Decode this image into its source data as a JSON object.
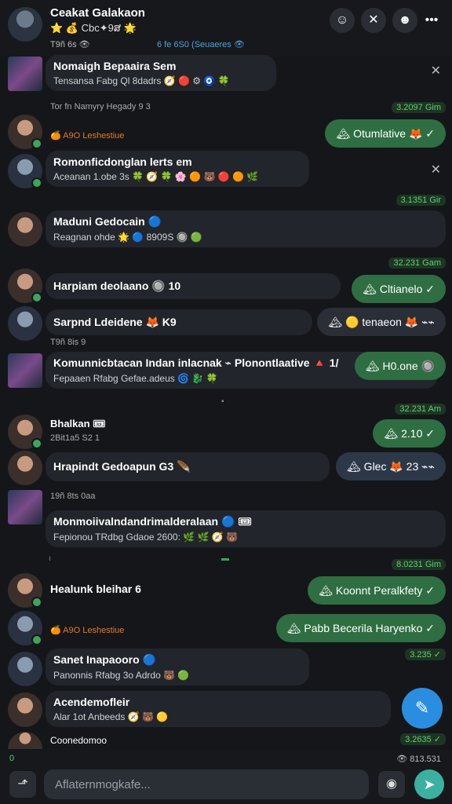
{
  "header": {
    "title": "Ceakat Galakaon",
    "subtitle": "⭐ 💰 Cbc✦9ສ 🌟",
    "meta_left": "T9ñ 6s 👁",
    "meta_center": "6 fe 6S0 (Seuaeres 👁",
    "icons": {
      "profile": "profile-icon",
      "close": "close-icon",
      "user": "user-icon",
      "more": "more-icon"
    },
    "more_glyph": "•••",
    "close_glyph": "✕"
  },
  "messages": [
    {
      "title": "Nomaigh Bepaaira Sem",
      "sub": "Tensansa Fabg Ql 8dadrs 🧭 🔴 ⚙ 🧿 🍀",
      "close": "✕"
    },
    {
      "meta": "Tor fn Namyry Hegady 9 3",
      "time": "3.2097 Gim"
    },
    {
      "meta": "🍊 A9O Leshestiue",
      "pill": "🏔 Otumlative 🦊 ✓"
    },
    {
      "title": "Romonficdonglan lerts em",
      "sub": "Aceanan 1.obe 3s 🍀 🧭 🍀 🌸 🟠 🐻 🔴 🟠 🌿",
      "close": "✕"
    },
    {
      "time": "3.1351 Gir"
    },
    {
      "title": "Maduni Gedocain 🔵",
      "sub": "Reagnan ohde 🌟 🔵 8909S 🔘 🟢"
    },
    {
      "time": "32.231 Gam"
    },
    {
      "title": "Harpiam deolaano 🔘 10",
      "pill": "🏔 Cltianelo ✓"
    },
    {
      "title": "Sarpnd Ldeidene 🦊 K9",
      "pill": "🏔 🟡 tenaeon 🦊 ⌁⌁"
    },
    {
      "meta": "T9ñ 8is 9"
    },
    {
      "title": "Komunnicbtacan Indan inlacnak ⌁ Plonontlaative 🔺 1/",
      "sub": "Fepaaen Rfabg Gefae.adeus 🌀 🐉 🍀",
      "pill": "🏔 H0.one 🔘"
    },
    {
      "time": "32.231 Am"
    },
    {
      "title": "Bhalkan 🎟",
      "sub": "2Bit1a5 S2 1",
      "pill": "🏔 2.10 ✓"
    },
    {
      "title": "Hrapindt Gedoapun G3 🪶",
      "pill": "🏔 Glec 🦊 23 ⌁⌁"
    },
    {
      "meta": "19ñ 8ts 0aa"
    },
    {
      "title": "Monmoiivalndandrimalderalaan 🔵 🎟",
      "sub": "Fepionou TRdbg Gdaoe 2600: 🌿 🌿 🧭 🐻"
    },
    {
      "time": "8.0231 Gim"
    },
    {
      "title": "Healunk bleihar 6",
      "pill": "🏔 Koonnt Peralkfety ✓"
    },
    {
      "meta": "🍊 A9O Leshestiue",
      "pill": "🏔 Pabb Becerila Haryenko ✓"
    },
    {
      "title": "Sanet Inapaooro 🔵",
      "sub": "Panonnis Rfabg 3o Adrdo 🐻 🟢",
      "time": "3.235 ✓"
    },
    {
      "title": "Acendemofleir",
      "sub": "Alar 1ot Anbeeds 🧭 🐻 🟡"
    },
    {
      "title": "Coonedomoo",
      "time": "3.2635 ✓"
    }
  ],
  "footer": {
    "status_left": "0",
    "status_right": "👁 813.531",
    "placeholder": "Aflaternmogkafe...",
    "icons": {
      "attach": "attach-icon",
      "camera": "camera-icon",
      "send": "send-icon"
    }
  },
  "fab": {
    "icon": "edit-icon",
    "glyph": "✎"
  },
  "colors": {
    "accent_green": "#2f6e42",
    "time_green": "#5fd070",
    "fab_blue": "#2a8ee0",
    "send_teal": "#3bb0a0",
    "background": "#14161a"
  }
}
